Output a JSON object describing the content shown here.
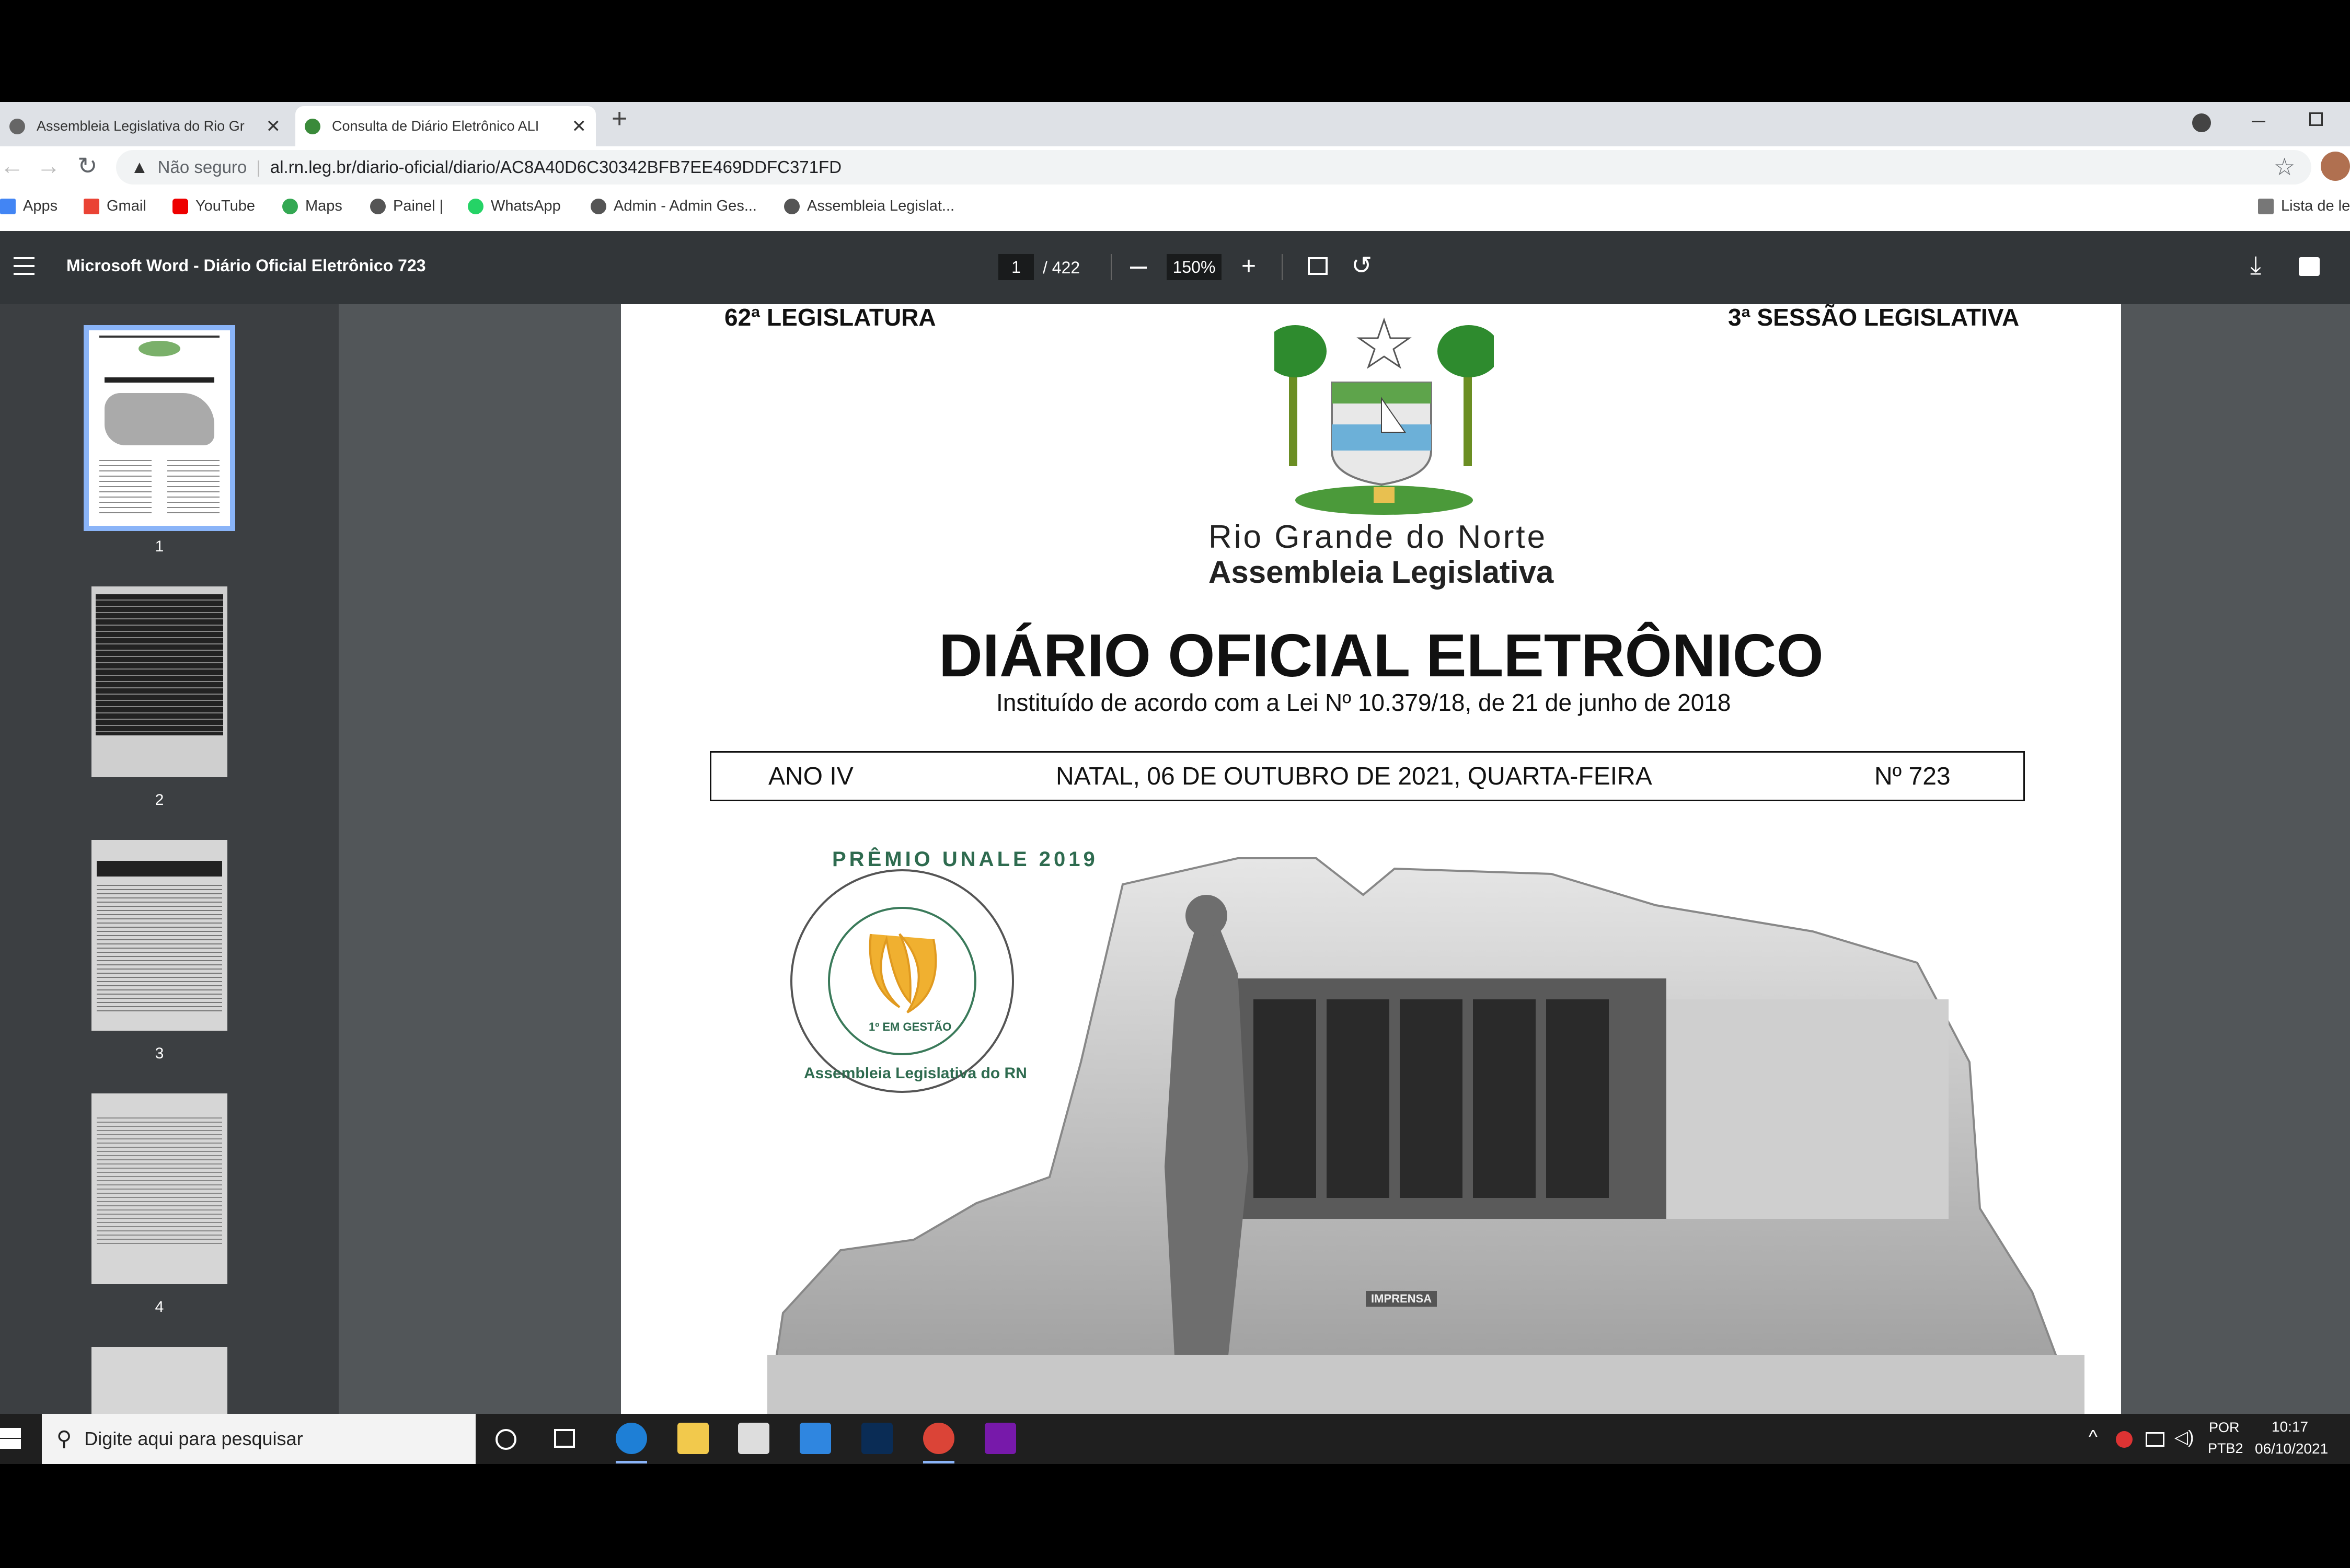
{
  "browser": {
    "tabs": [
      {
        "title": "Assembleia Legislativa do Rio Gr",
        "active": false
      },
      {
        "title": "Consulta de Diário Eletrônico ALI",
        "active": true
      }
    ],
    "new_tab_label": "+",
    "address": {
      "security_label": "Não seguro",
      "url": "al.rn.leg.br/diario-oficial/diario/AC8A40D6C30342BFB7EE469DDFC371FD"
    },
    "bookmarks": [
      "Apps",
      "Gmail",
      "YouTube",
      "Maps",
      "Painel |",
      "WhatsApp",
      "Admin - Admin Ges...",
      "Assembleia Legislat..."
    ],
    "reading_list_label": "Lista de le"
  },
  "pdf": {
    "title": "Microsoft Word - Diário Oficial Eletrônico 723",
    "current_page": "1",
    "total_pages": "/ 422",
    "zoom": "150%",
    "thumbnails": [
      "1",
      "2",
      "3",
      "4"
    ]
  },
  "document": {
    "legislatura": "62ª LEGISLATURA",
    "sessao": "3ª SESSÃO LEGISLATIVA",
    "state": "Rio Grande do Norte",
    "assembly": "Assembleia Legislativa",
    "heading": "DIÁRIO OFICIAL ELETRÔNICO",
    "subheading": "Instituído de acordo com a Lei Nº 10.379/18, de 21 de junho de 2018",
    "ano": "ANO IV",
    "date": "NATAL, 06 DE OUTUBRO DE 2021, QUARTA-FEIRA",
    "numero": "Nº 723",
    "seal_top": "PRÊMIO UNALE 2019",
    "seal_mid": "1º EM GESTÃO",
    "seal_bottom": "Assembleia Legislativa do RN",
    "building_sign": "IMPRENSA"
  },
  "taskbar": {
    "search_placeholder": "Digite aqui para pesquisar",
    "lang_top": "POR",
    "lang_bottom": "PTB2",
    "time": "10:17",
    "date": "06/10/2021"
  },
  "colors": {
    "accent": "#8ab4f8",
    "pdf_toolbar": "#323639",
    "viewer_bg": "#525659"
  }
}
